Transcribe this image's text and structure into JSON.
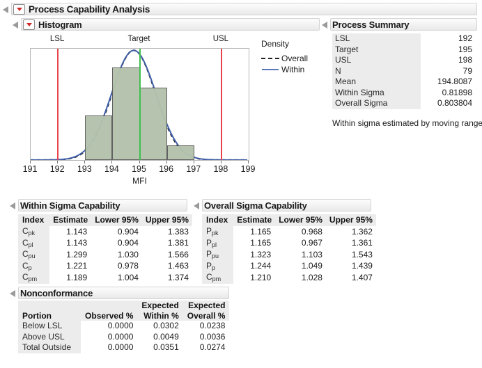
{
  "root": {
    "title": "Process Capability Analysis"
  },
  "histogram": {
    "title": "Histogram",
    "spec_labels": {
      "lsl": "LSL",
      "target": "Target",
      "usl": "USL"
    },
    "xaxis_title": "MFI",
    "legend": {
      "title": "Density",
      "overall": "Overall",
      "within": "Within"
    }
  },
  "summary": {
    "title": "Process Summary",
    "rows": [
      {
        "label": "LSL",
        "value": "192"
      },
      {
        "label": "Target",
        "value": "195"
      },
      {
        "label": "USL",
        "value": "198"
      },
      {
        "label": "N",
        "value": "79"
      },
      {
        "label": "Mean",
        "value": "194.8087"
      },
      {
        "label": "Within Sigma",
        "value": "0.81898"
      },
      {
        "label": "Overall Sigma",
        "value": "0.803804"
      }
    ],
    "note": "Within sigma estimated by moving range."
  },
  "within": {
    "title": "Within Sigma Capability",
    "columns": [
      "Index",
      "Estimate",
      "Lower 95%",
      "Upper 95%"
    ],
    "rows": [
      {
        "index": "Cpk",
        "index_main": "C",
        "index_sub": "pk",
        "estimate": "1.143",
        "lower": "0.904",
        "upper": "1.383"
      },
      {
        "index": "Cpl",
        "index_main": "C",
        "index_sub": "pl",
        "estimate": "1.143",
        "lower": "0.904",
        "upper": "1.381"
      },
      {
        "index": "Cpu",
        "index_main": "C",
        "index_sub": "pu",
        "estimate": "1.299",
        "lower": "1.030",
        "upper": "1.566"
      },
      {
        "index": "Cp",
        "index_main": "C",
        "index_sub": "p",
        "estimate": "1.221",
        "lower": "0.978",
        "upper": "1.463"
      },
      {
        "index": "Cpm",
        "index_main": "C",
        "index_sub": "pm",
        "estimate": "1.189",
        "lower": "1.004",
        "upper": "1.374"
      }
    ]
  },
  "overall": {
    "title": "Overall Sigma Capability",
    "columns": [
      "Index",
      "Estimate",
      "Lower 95%",
      "Upper 95%"
    ],
    "rows": [
      {
        "index": "Ppk",
        "index_main": "P",
        "index_sub": "pk",
        "estimate": "1.165",
        "lower": "0.968",
        "upper": "1.362"
      },
      {
        "index": "Ppl",
        "index_main": "P",
        "index_sub": "pl",
        "estimate": "1.165",
        "lower": "0.967",
        "upper": "1.361"
      },
      {
        "index": "Ppu",
        "index_main": "P",
        "index_sub": "pu",
        "estimate": "1.323",
        "lower": "1.103",
        "upper": "1.543"
      },
      {
        "index": "Pp",
        "index_main": "P",
        "index_sub": "p",
        "estimate": "1.244",
        "lower": "1.049",
        "upper": "1.439"
      },
      {
        "index": "Cpm",
        "index_main": "C",
        "index_sub": "pm",
        "estimate": "1.210",
        "lower": "1.028",
        "upper": "1.407"
      }
    ]
  },
  "nonconformance": {
    "title": "Nonconformance",
    "columns": [
      {
        "line1": "",
        "line2": "Portion"
      },
      {
        "line1": "",
        "line2": "Observed %"
      },
      {
        "line1": "Expected",
        "line2": "Within %"
      },
      {
        "line1": "Expected",
        "line2": "Overall %"
      }
    ],
    "rows": [
      {
        "portion": "Below LSL",
        "observed": "0.0000",
        "within": "0.0302",
        "overall": "0.0238"
      },
      {
        "portion": "Above USL",
        "observed": "0.0000",
        "within": "0.0049",
        "overall": "0.0036"
      },
      {
        "portion": "Total Outside",
        "observed": "0.0000",
        "within": "0.0351",
        "overall": "0.0274"
      }
    ]
  },
  "chart_data": {
    "type": "bar",
    "title": "Histogram",
    "xlabel": "MFI",
    "ylabel": "Density",
    "xlim": [
      191,
      199
    ],
    "tick_labels": [
      "191",
      "192",
      "193",
      "194",
      "195",
      "196",
      "197",
      "198",
      "199"
    ],
    "bins": [
      {
        "from": 193,
        "to": 194,
        "height_frac": 0.402
      },
      {
        "from": 194,
        "to": 195,
        "height_frac": 0.833
      },
      {
        "from": 195,
        "to": 196,
        "height_frac": 0.648
      },
      {
        "from": 196,
        "to": 197,
        "height_frac": 0.13
      }
    ],
    "reference_lines": [
      {
        "name": "LSL",
        "value": 192,
        "color": "#e8434b"
      },
      {
        "name": "Target",
        "value": 195,
        "color": "#3fbf4f"
      },
      {
        "name": "USL",
        "value": 198,
        "color": "#e8434b"
      }
    ],
    "curves": [
      {
        "name": "Overall",
        "style": "dashed",
        "color": "#222222",
        "mean": 194.8087,
        "sigma": 0.803804
      },
      {
        "name": "Within",
        "style": "solid",
        "color": "#3f5fa8",
        "mean": 194.8087,
        "sigma": 0.81898
      }
    ],
    "grid": false,
    "legend_position": "right"
  }
}
